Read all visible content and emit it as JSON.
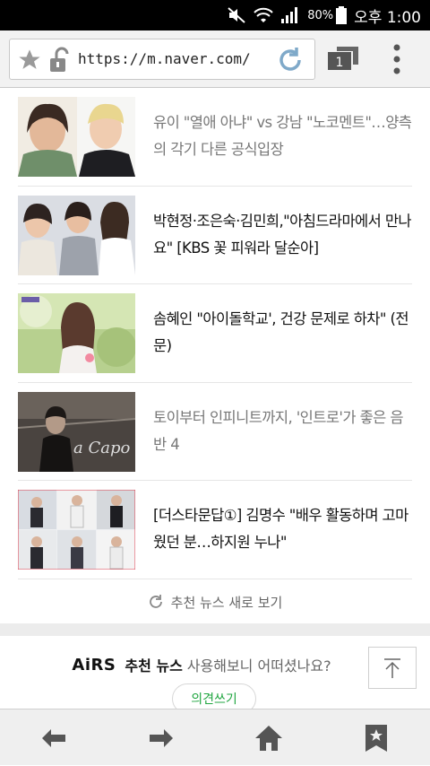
{
  "status_bar": {
    "battery": "80%",
    "time": "오후 1:00"
  },
  "browser": {
    "url": "https://m.naver.com/",
    "tab_count": "1",
    "icons": [
      "star-icon",
      "lock-icon",
      "reload-icon",
      "tabs-icon",
      "overflow-menu-icon"
    ]
  },
  "news": {
    "items": [
      {
        "headline": "유이 \"열애 아냐\" vs 강남 \"노코멘트\"…양측의 각기 다른 공식입장",
        "visited": true
      },
      {
        "headline": "박현정·조은숙·김민희,\"아침드라마에서 만나요\" [KBS 꽃 피워라 달순아]",
        "visited": false
      },
      {
        "headline": "솜혜인 \"아이돌학교', 건강 문제로 하차\" (전문)",
        "visited": false
      },
      {
        "headline": "토이부터 인피니트까지, '인트로'가 좋은 음반 4",
        "visited": true
      },
      {
        "headline": "[더스타문답①] 김명수 \"배우 활동하며 고마웠던 분…하지원 누나\"",
        "visited": false
      }
    ],
    "refresh_label": "추천 뉴스 새로 보기"
  },
  "feedback": {
    "brand": "AiRS",
    "brand_sub": "추천 뉴스",
    "question": "사용해보니 어떠셨나요?",
    "opinion_button": "의견쓰기"
  },
  "bottom_nav": {
    "icons": [
      "back-arrow-icon",
      "forward-arrow-icon",
      "home-icon",
      "bookmarks-icon"
    ]
  },
  "colors": {
    "accent_green": "#20a640",
    "reload_blue": "#7fa9c9",
    "toolbar_bg": "#f2f2f2"
  }
}
